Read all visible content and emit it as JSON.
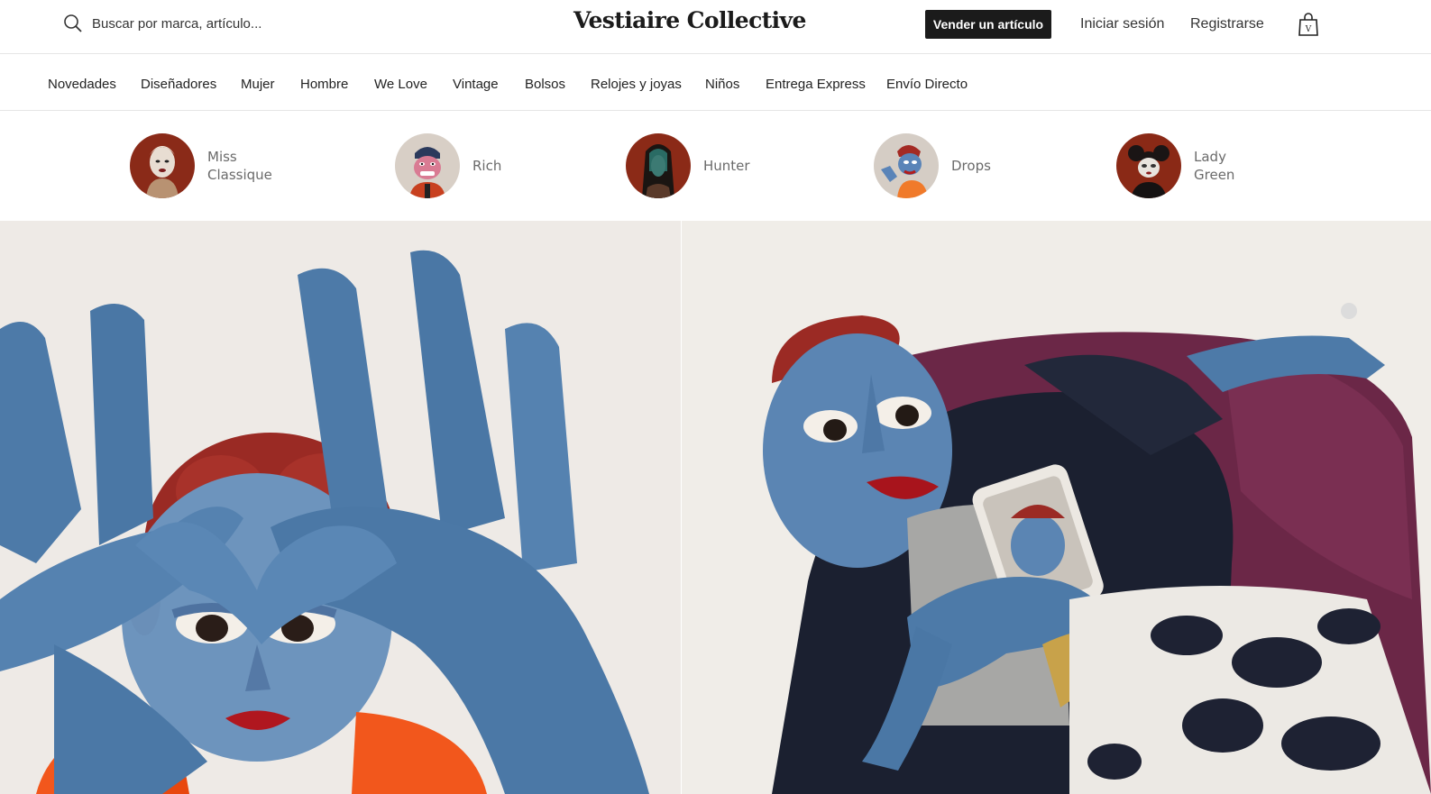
{
  "header": {
    "search_placeholder": "Buscar por marca, artículo...",
    "logo": "Vestiaire Collective",
    "sell_label": "Vender un artículo",
    "login_label": "Iniciar sesión",
    "register_label": "Registrarse",
    "bag_icon": "shopping-bag-icon",
    "search_icon": "search-icon"
  },
  "nav": {
    "items": [
      "Novedades",
      "Diseñadores",
      "Mujer",
      "Hombre",
      "We Love",
      "Vintage",
      "Bolsos",
      "Relojes y joyas",
      "Niños",
      "Entrega Express",
      "Envío Directo"
    ]
  },
  "stories": [
    {
      "label": "Miss\nClassique",
      "bg": "#8a2a18"
    },
    {
      "label": "Rich",
      "bg": "#d8cfc6"
    },
    {
      "label": "Hunter",
      "bg": "#8b2a17"
    },
    {
      "label": "Drops",
      "bg": "#d5cdc5"
    },
    {
      "label": "Lady\nGreen",
      "bg": "#8a2916"
    }
  ],
  "colors": {
    "accent_dark": "#1b1b1b",
    "denim": "#4d7aa8",
    "hair_red": "#9a2a24",
    "chair_purple": "#6e2a4a"
  }
}
